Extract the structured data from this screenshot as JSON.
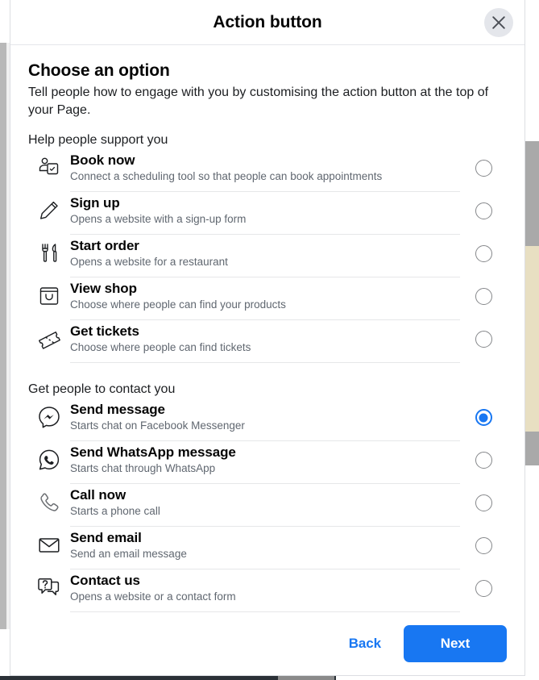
{
  "dialog": {
    "title": "Action button",
    "close_icon": "close-icon",
    "heading": "Choose an option",
    "description": "Tell people how to engage with you by customising the action button at the top of your Page.",
    "groups": [
      {
        "title": "Help people support you",
        "options": [
          {
            "icon": "booking-person-icon",
            "label": "Book now",
            "desc": "Connect a scheduling tool so that people can book appointments",
            "selected": false
          },
          {
            "icon": "pencil-icon",
            "label": "Sign up",
            "desc": "Opens a website with a sign-up form",
            "selected": false
          },
          {
            "icon": "fork-knife-icon",
            "label": "Start order",
            "desc": "Opens a website for a restaurant",
            "selected": false
          },
          {
            "icon": "shopping-bag-icon",
            "label": "View shop",
            "desc": "Choose where people can find your products",
            "selected": false
          },
          {
            "icon": "ticket-icon",
            "label": "Get tickets",
            "desc": "Choose where people can find tickets",
            "selected": false
          }
        ]
      },
      {
        "title": "Get people to contact you",
        "options": [
          {
            "icon": "messenger-icon",
            "label": "Send message",
            "desc": "Starts chat on Facebook Messenger",
            "selected": true
          },
          {
            "icon": "whatsapp-icon",
            "label": "Send WhatsApp message",
            "desc": "Starts chat through WhatsApp",
            "selected": false
          },
          {
            "icon": "phone-icon",
            "label": "Call now",
            "desc": "Starts a phone call",
            "selected": false
          },
          {
            "icon": "envelope-icon",
            "label": "Send email",
            "desc": "Send an email message",
            "selected": false
          },
          {
            "icon": "question-chat-icon",
            "label": "Contact us",
            "desc": "Opens a website or a contact form",
            "selected": false
          }
        ]
      }
    ],
    "footer": {
      "back_label": "Back",
      "next_label": "Next"
    }
  },
  "colors": {
    "accent_blue": "#1877f2",
    "text_primary": "#050505",
    "text_secondary": "#606770",
    "divider": "#e6e7e9"
  }
}
